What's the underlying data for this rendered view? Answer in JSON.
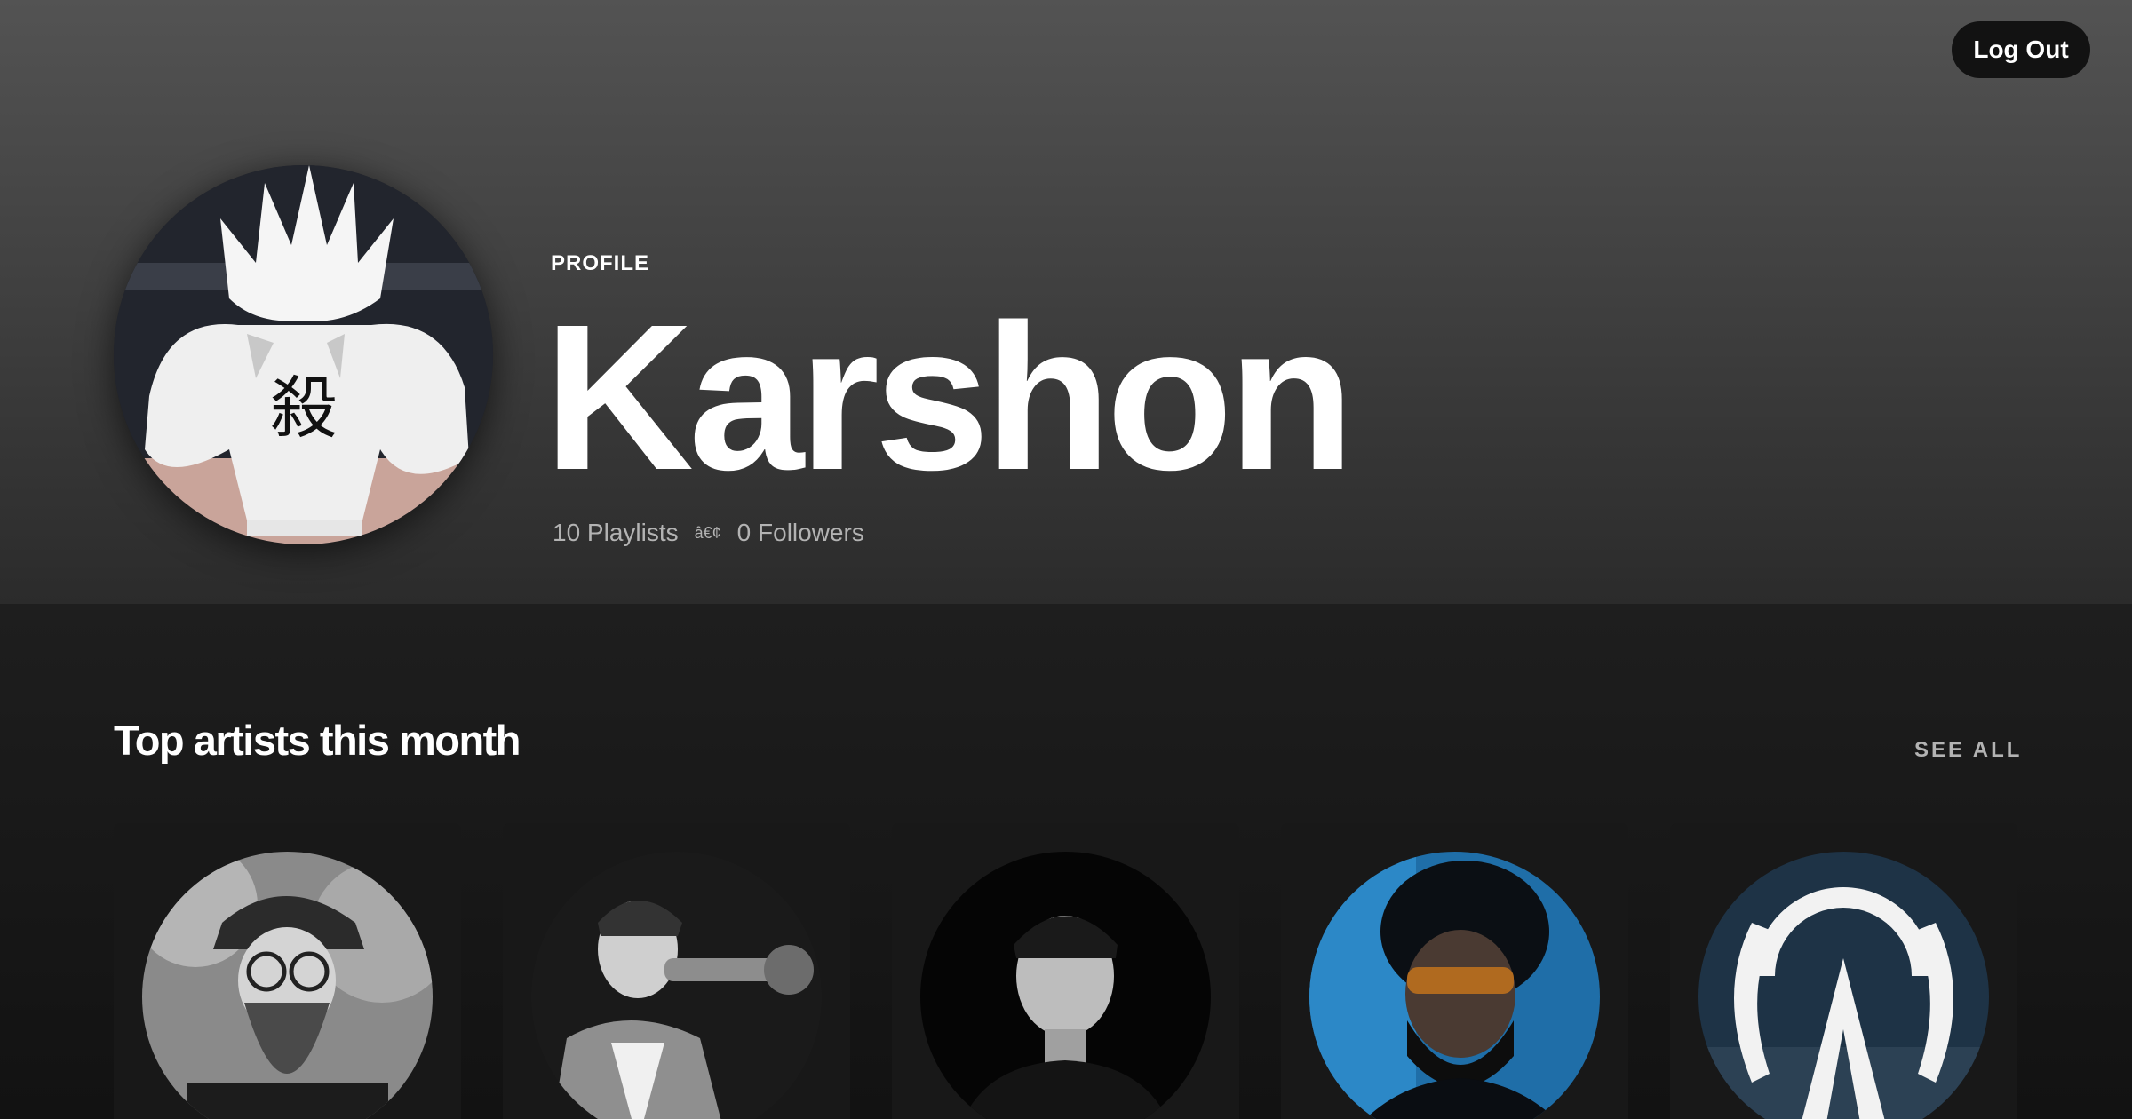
{
  "header": {
    "label": "PROFILE",
    "name": "Karshon",
    "playlists": "10 Playlists",
    "separator": "â€¢",
    "followers": "0 Followers"
  },
  "actions": {
    "logout_label": "Log Out"
  },
  "section": {
    "title": "Top artists this month",
    "see_all": "SEE ALL"
  },
  "artists": [
    {
      "icon": "artist-portrait"
    },
    {
      "icon": "artist-portrait"
    },
    {
      "icon": "artist-portrait"
    },
    {
      "icon": "artist-portrait"
    },
    {
      "icon": "artist-logo"
    }
  ],
  "colors": {
    "background": "#121212",
    "card": "#181818",
    "muted_text": "#b3b3b3"
  }
}
